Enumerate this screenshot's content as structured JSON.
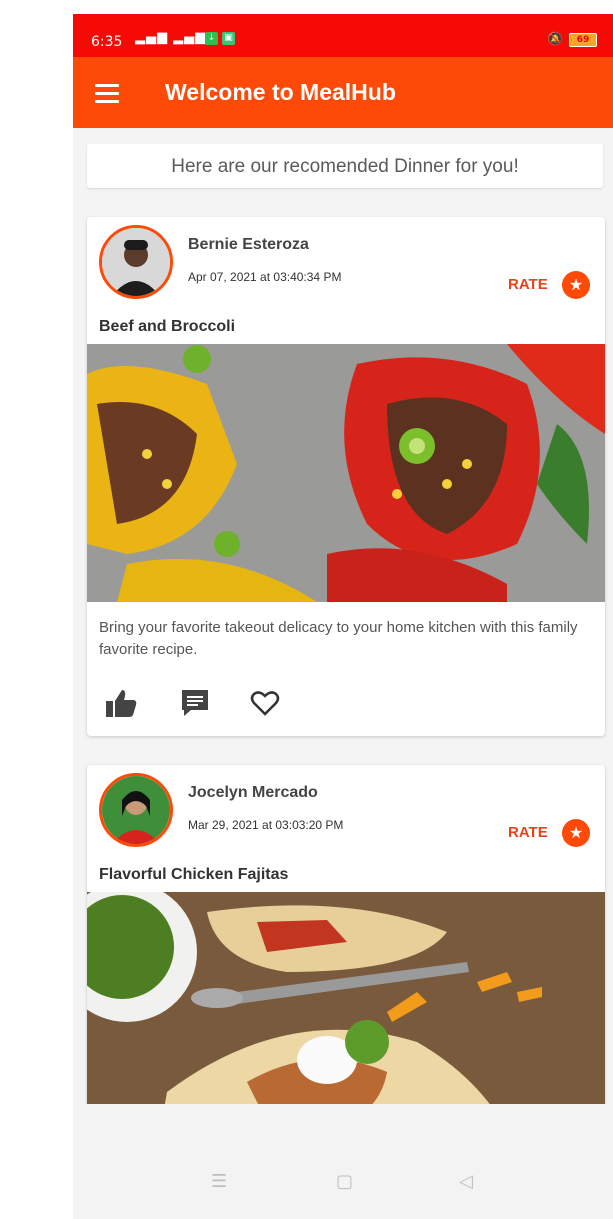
{
  "status_bar": {
    "time": "6:35",
    "battery": "69",
    "icons": [
      "signal-icon",
      "download-icon",
      "image-icon",
      "mute-icon",
      "battery-icon"
    ]
  },
  "app_bar": {
    "title": "Welcome to MealHub",
    "menu_icon": "hamburger-menu-icon",
    "color": "#fe4a08"
  },
  "banner": {
    "text": "Here are our recomended Dinner for you!"
  },
  "posts": [
    {
      "author": "Bernie Esteroza",
      "date": "Apr 07, 2021 at 03:40:34 PM",
      "rate_label": "RATE",
      "title": "Beef and Broccoli",
      "description": "Bring your favorite takeout delicacy to your home kitchen with this family favorite recipe.",
      "actions": [
        "thumbs-up-icon",
        "comment-icon",
        "heart-icon"
      ]
    },
    {
      "author": "Jocelyn Mercado",
      "date": "Mar 29, 2021 at 03:03:20 PM",
      "rate_label": "RATE",
      "title": "Flavorful Chicken Fajitas"
    }
  ],
  "nav_bar": {
    "icons": [
      "recents-icon",
      "home-icon",
      "back-icon"
    ]
  },
  "colors": {
    "status_bar": "#f50a05",
    "accent": "#fe4a08",
    "rate_text": "#e8431a"
  }
}
